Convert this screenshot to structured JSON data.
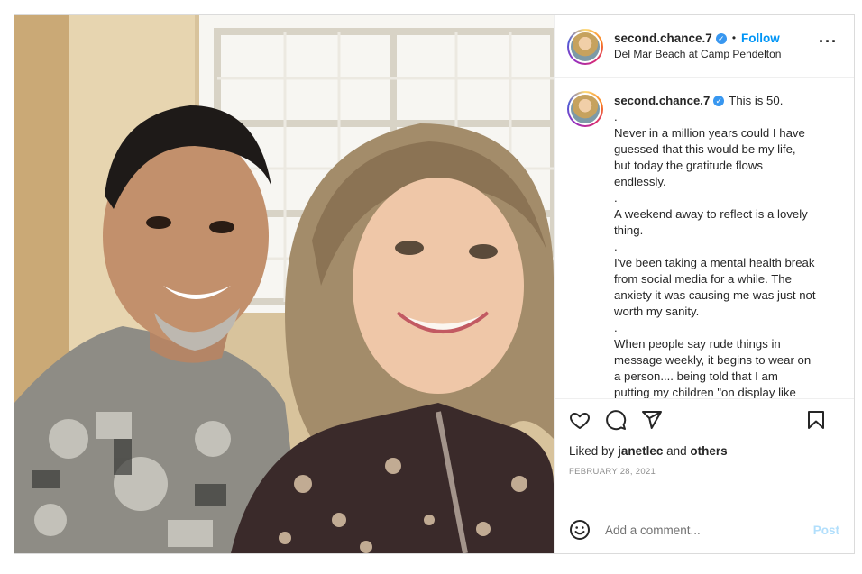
{
  "post": {
    "username": "second.chance.7",
    "follow_label": "Follow",
    "location": "Del Mar Beach at Camp Pendelton",
    "caption_first": "This is 50.",
    "caption_lines": [
      ".",
      "Never in a million years could I have",
      "guessed that this would be my life,",
      "but today the gratitude flows",
      "endlessly.",
      ".",
      "A weekend away to reflect is a lovely",
      "thing.",
      ".",
      "I've been taking a mental health break",
      "from social media for a while. The",
      "anxiety it was causing me was just not",
      "worth my sanity.",
      ".",
      "When people say rude things in",
      "message weekly, it begins to wear on",
      "a person.... being told that I am",
      "putting my children \"on display like"
    ],
    "liked_by_prefix": "Liked by",
    "liked_by_user": "janetlec",
    "liked_by_and": "and",
    "liked_by_others": "others",
    "date": "FEBRUARY 28, 2021",
    "comment_placeholder": "Add a comment...",
    "post_label": "Post"
  },
  "icons": {
    "verified": "verified-badge-icon",
    "more": "more-options-icon",
    "like": "heart-icon",
    "comment": "comment-bubble-icon",
    "share": "paper-plane-icon",
    "save": "bookmark-icon",
    "emoji": "smiley-icon"
  },
  "colors": {
    "accent": "#0095f6",
    "verified": "#3897f0",
    "post_disabled": "#b2dffc",
    "muted": "#8e8e8e"
  }
}
